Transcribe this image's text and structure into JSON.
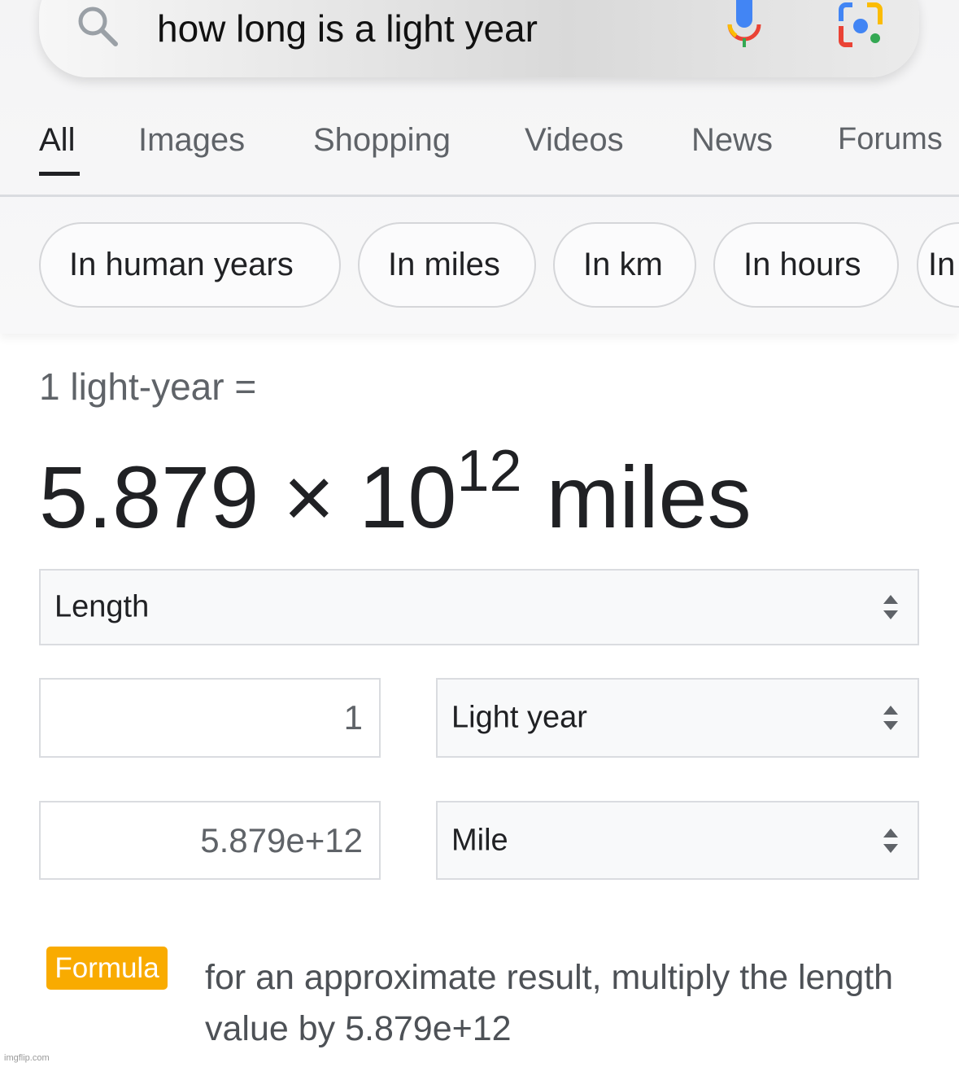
{
  "search": {
    "query": "how long is a light year",
    "icons": [
      "search-icon",
      "mic-icon",
      "lens-icon"
    ]
  },
  "tabs": [
    {
      "label": "All",
      "active": true
    },
    {
      "label": "Images"
    },
    {
      "label": "Shopping"
    },
    {
      "label": "Videos"
    },
    {
      "label": "News"
    },
    {
      "label": "Forums"
    }
  ],
  "chips": [
    "In human years",
    "In miles",
    "In km",
    "In hours",
    "In"
  ],
  "result": {
    "equation": "1 light-year =",
    "mantissa": "5.879 × 10",
    "exponent": "12",
    "unit": "miles"
  },
  "converter": {
    "category": "Length",
    "from_value": "1",
    "from_unit": "Light year",
    "to_value": "5.879e+12",
    "to_unit": "Mile"
  },
  "formula": {
    "badge": "Formula",
    "text": "for an approximate result, multiply the length value by 5.879e+12",
    "badge_color": "#f9ab00"
  },
  "watermark": "imgflip.com"
}
